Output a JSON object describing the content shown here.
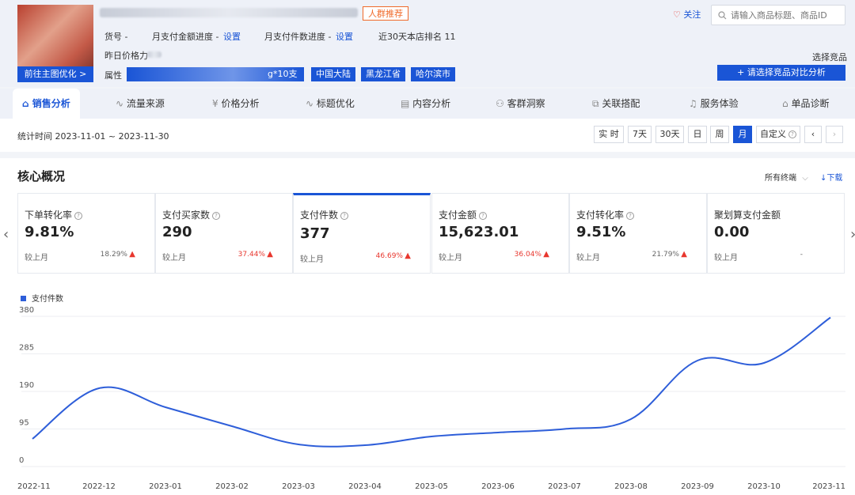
{
  "header": {
    "thumbnail_button": "前往主图优化 >",
    "recommend_tag": "人群推荐",
    "item_no_label": "货号 -",
    "monthly_amount_label": "月支付金额进度 -",
    "monthly_amount_link": "设置",
    "monthly_count_label": "月支付件数进度 -",
    "monthly_count_link": "设置",
    "rank_text": "近30天本店排名 11",
    "yesterday_price_label": "昨日价格力",
    "attr_label": "属性",
    "attr_tags": [
      "g*10支",
      "中国大陆",
      "黑龙江省",
      "哈尔滨市"
    ],
    "follow_label": "关注",
    "search_placeholder": "请输入商品标题、商品ID",
    "choose_competitor": "选择竞品",
    "compare_button": "+ 请选择竞品对比分析"
  },
  "tabs": [
    {
      "label": "销售分析",
      "icon": "home-icon",
      "active": true
    },
    {
      "label": "流量来源",
      "icon": "trend-icon"
    },
    {
      "label": "价格分析",
      "icon": "yen-icon"
    },
    {
      "label": "标题优化",
      "icon": "trend-icon"
    },
    {
      "label": "内容分析",
      "icon": "doc-icon"
    },
    {
      "label": "客群洞察",
      "icon": "people-icon"
    },
    {
      "label": "关联搭配",
      "icon": "link-icon"
    },
    {
      "label": "服务体验",
      "icon": "headset-icon"
    },
    {
      "label": "单品诊断",
      "icon": "home-icon"
    }
  ],
  "datebar": {
    "range_text": "统计时间 2023-11-01 ~ 2023-11-30",
    "buttons": [
      "实 时",
      "7天",
      "30天",
      "日",
      "周",
      "月",
      "自定义"
    ],
    "active": "月"
  },
  "core": {
    "title": "核心概况",
    "terminal_select": "所有终端",
    "download": "下载"
  },
  "kpis": [
    {
      "title": "下单转化率",
      "value": "9.81%",
      "cmp_label": "较上月",
      "pct": "18.29%",
      "up": true,
      "pct_color": "#666666"
    },
    {
      "title": "支付买家数",
      "value": "290",
      "cmp_label": "较上月",
      "pct": "37.44%",
      "up": true,
      "pct_color": "#e8372e"
    },
    {
      "title": "支付件数",
      "value": "377",
      "cmp_label": "较上月",
      "pct": "46.69%",
      "up": true,
      "pct_color": "#e8372e",
      "active": true
    },
    {
      "title": "支付金额",
      "value": "15,623.01",
      "cmp_label": "较上月",
      "pct": "36.04%",
      "up": true,
      "pct_color": "#e8372e"
    },
    {
      "title": "支付转化率",
      "value": "9.51%",
      "cmp_label": "较上月",
      "pct": "21.79%",
      "up": true,
      "pct_color": "#666666"
    },
    {
      "title": "聚划算支付金额",
      "value": "0.00",
      "cmp_label": "较上月",
      "pct": "-",
      "up": false,
      "pct_color": "#666666"
    }
  ],
  "accent_color": "#1a55d6",
  "chart_data": {
    "type": "line",
    "legend": "支付件数",
    "categories": [
      "2022-11",
      "2022-12",
      "2023-01",
      "2023-02",
      "2023-03",
      "2023-04",
      "2023-05",
      "2023-06",
      "2023-07",
      "2023-08",
      "2023-09",
      "2023-10",
      "2023-11"
    ],
    "series": [
      {
        "name": "支付件数",
        "values": [
          70,
          198,
          150,
          102,
          56,
          54,
          76,
          86,
          95,
          120,
          268,
          262,
          377
        ]
      }
    ],
    "y_ticks": [
      0,
      95,
      190,
      285,
      380
    ],
    "ylim": [
      0,
      380
    ],
    "grid": true,
    "legend_position": "top-left",
    "color": "#2e5ed9"
  }
}
